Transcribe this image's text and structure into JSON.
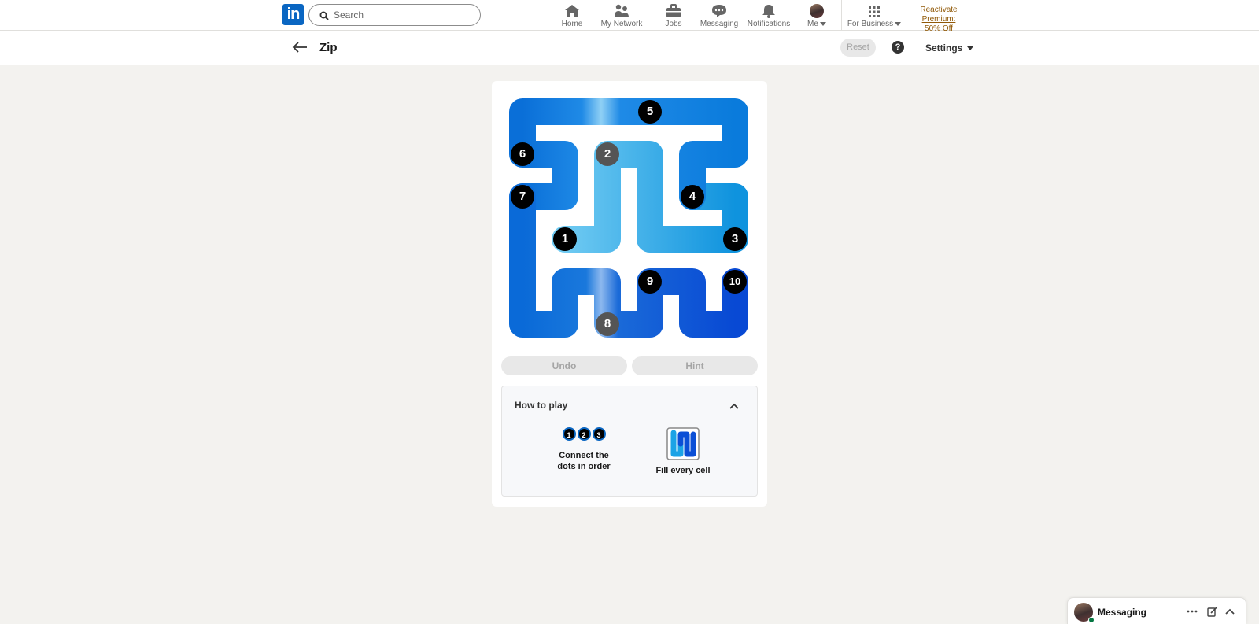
{
  "nav": {
    "logo_text": "in",
    "search_placeholder": "Search",
    "items": [
      {
        "label": "Home",
        "icon": "home-icon"
      },
      {
        "label": "My Network",
        "icon": "network-icon"
      },
      {
        "label": "Jobs",
        "icon": "briefcase-icon"
      },
      {
        "label": "Messaging",
        "icon": "chat-icon"
      },
      {
        "label": "Notifications",
        "icon": "bell-icon"
      },
      {
        "label": "Me",
        "icon": "avatar"
      },
      {
        "label": "For Business",
        "icon": "grid-icon"
      }
    ],
    "premium_line1": "Reactivate Premium:",
    "premium_line2": "50% Off"
  },
  "subheader": {
    "title": "Zip",
    "reset_label": "Reset",
    "help_glyph": "?",
    "settings_label": "Settings"
  },
  "game": {
    "dots": [
      {
        "n": "1",
        "variant": "black"
      },
      {
        "n": "2",
        "variant": "grey"
      },
      {
        "n": "3",
        "variant": "black"
      },
      {
        "n": "4",
        "variant": "black"
      },
      {
        "n": "5",
        "variant": "black"
      },
      {
        "n": "6",
        "variant": "black"
      },
      {
        "n": "7",
        "variant": "black"
      },
      {
        "n": "8",
        "variant": "grey"
      },
      {
        "n": "9",
        "variant": "black"
      },
      {
        "n": "10",
        "variant": "black"
      }
    ],
    "path_colors": [
      "#0a6fd8",
      "#1ca3e6",
      "#6fcaf2",
      "#0b4fd6"
    ],
    "undo_label": "Undo",
    "hint_label": "Hint"
  },
  "howto": {
    "title": "How to play",
    "rule1_dots": [
      "1",
      "2",
      "3"
    ],
    "rule1_line1": "Connect the",
    "rule1_line2": "dots in order",
    "rule2_label": "Fill every cell"
  },
  "messaging": {
    "label": "Messaging"
  }
}
